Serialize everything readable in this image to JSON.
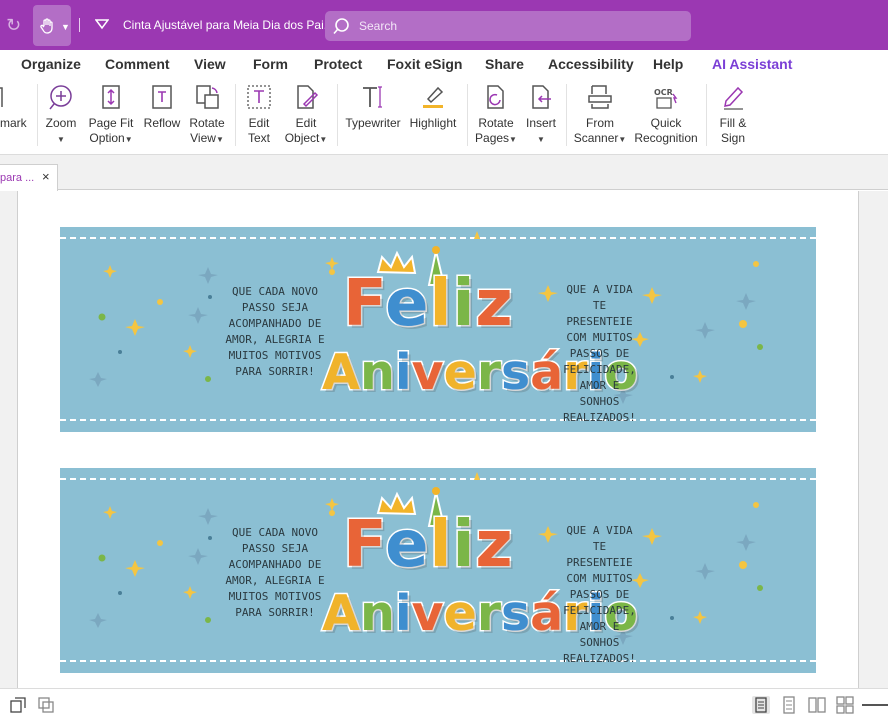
{
  "titlebar": {
    "title": "Cinta Ajustável para Meia Dia dos Pai...",
    "search_placeholder": "Search"
  },
  "menu": {
    "tabs": [
      "Organize",
      "Comment",
      "View",
      "Form",
      "Protect",
      "Foxit eSign",
      "Share",
      "Accessibility",
      "Help",
      "AI Assistant"
    ]
  },
  "ribbon": {
    "bookmark": "mark",
    "zoom": "Zoom",
    "page_fit_1": "Page Fit",
    "page_fit_2": "Option",
    "reflow": "Reflow",
    "rotate_view_1": "Rotate",
    "rotate_view_2": "View",
    "edit_text_1": "Edit",
    "edit_text_2": "Text",
    "edit_object_1": "Edit",
    "edit_object_2": "Object",
    "typewriter": "Typewriter",
    "highlight": "Highlight",
    "rotate_pages_1": "Rotate",
    "rotate_pages_2": "Pages",
    "insert": "Insert",
    "from_scanner_1": "From",
    "from_scanner_2": "Scanner",
    "quick_recognition_1": "Quick",
    "quick_recognition_2": "Recognition",
    "fill_sign_1": "Fill &",
    "fill_sign_2": "Sign"
  },
  "doc_tab": {
    "name": "para ...",
    "close": "×"
  },
  "cards": [
    {
      "left_text": "Que cada novo passo seja acompanhado de amor, alegria e muitos motivos para sorrir!",
      "title_1": "Feliz",
      "title_2": "Aniversário",
      "right_text": "Que a vida te presenteie com muitos passos de felicidade, amor e sonhos realizados!"
    },
    {
      "left_text": "Que cada novo passo seja acompanhado de amor, alegria e muitos motivos para sorrir!",
      "title_1": "Feliz",
      "title_2": "Aniversário",
      "right_text": "Que a vida te presenteie com muitos passos de felicidade, amor e sonhos realizados!"
    }
  ],
  "colors": {
    "brand": "#9b38b2",
    "card_bg": "#8bbfd3",
    "ai_accent": "#7b3fd6"
  },
  "icons": [
    "redo-icon",
    "hand-tool-icon",
    "quick-access-dropdown-icon",
    "search-icon",
    "zoom-icon",
    "page-fit-icon",
    "reflow-icon",
    "rotate-view-icon",
    "edit-text-icon",
    "edit-object-icon",
    "typewriter-icon",
    "highlight-icon",
    "rotate-pages-icon",
    "insert-icon",
    "from-scanner-icon",
    "ocr-icon",
    "fill-sign-icon",
    "close-icon"
  ]
}
